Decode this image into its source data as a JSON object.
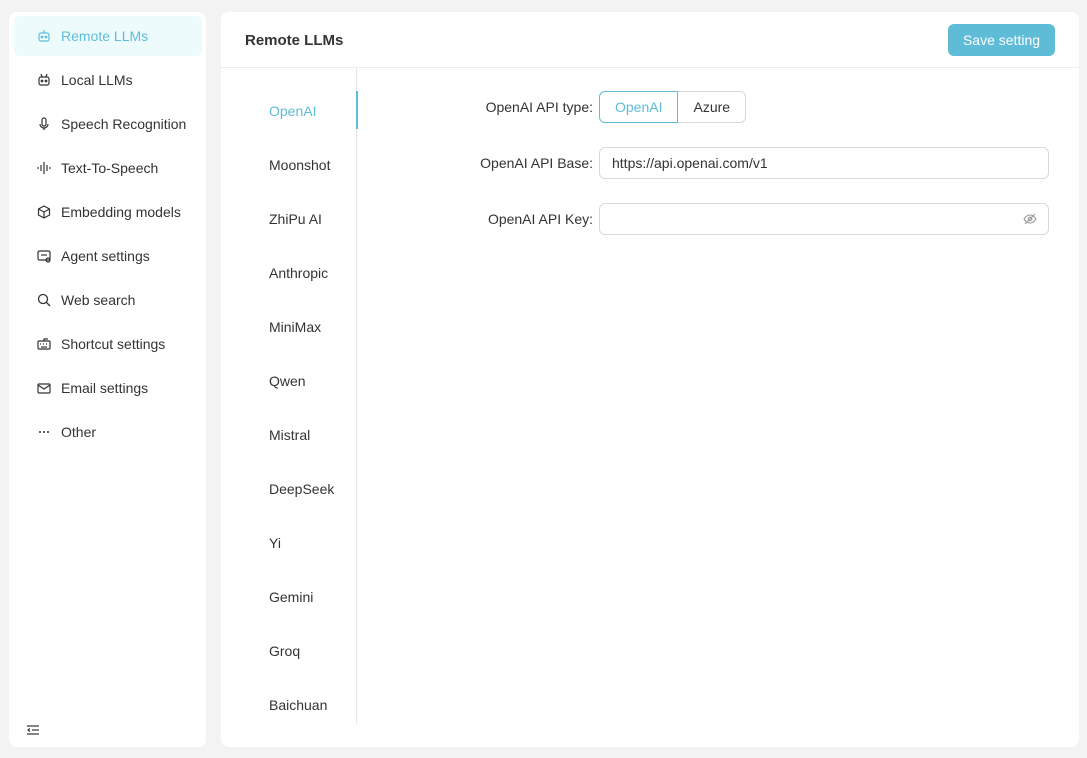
{
  "sidebar": {
    "items": [
      {
        "label": "Remote LLMs",
        "icon": "robot-icon"
      },
      {
        "label": "Local LLMs",
        "icon": "robot-icon"
      },
      {
        "label": "Speech Recognition",
        "icon": "microphone-icon"
      },
      {
        "label": "Text-To-Speech",
        "icon": "soundwave-icon"
      },
      {
        "label": "Embedding models",
        "icon": "cube-icon"
      },
      {
        "label": "Agent settings",
        "icon": "agent-icon"
      },
      {
        "label": "Web search",
        "icon": "search-icon"
      },
      {
        "label": "Shortcut settings",
        "icon": "keyboard-icon"
      },
      {
        "label": "Email settings",
        "icon": "mail-icon"
      },
      {
        "label": "Other",
        "icon": "ellipsis-icon"
      }
    ],
    "active_index": 0
  },
  "header": {
    "title": "Remote LLMs",
    "save_label": "Save setting"
  },
  "providers": {
    "items": [
      "OpenAI",
      "Moonshot",
      "ZhiPu AI",
      "Anthropic",
      "MiniMax",
      "Qwen",
      "Mistral",
      "DeepSeek",
      "Yi",
      "Gemini",
      "Groq",
      "Baichuan"
    ],
    "active_index": 0
  },
  "form": {
    "api_type_label": "OpenAI API type:",
    "api_type_options": [
      "OpenAI",
      "Azure"
    ],
    "api_type_selected": "OpenAI",
    "api_base_label": "OpenAI API Base:",
    "api_base_value": "https://api.openai.com/v1",
    "api_key_label": "OpenAI API Key:",
    "api_key_value": ""
  },
  "colors": {
    "accent": "#5fbcd6",
    "active_bg": "#eefbfd"
  }
}
